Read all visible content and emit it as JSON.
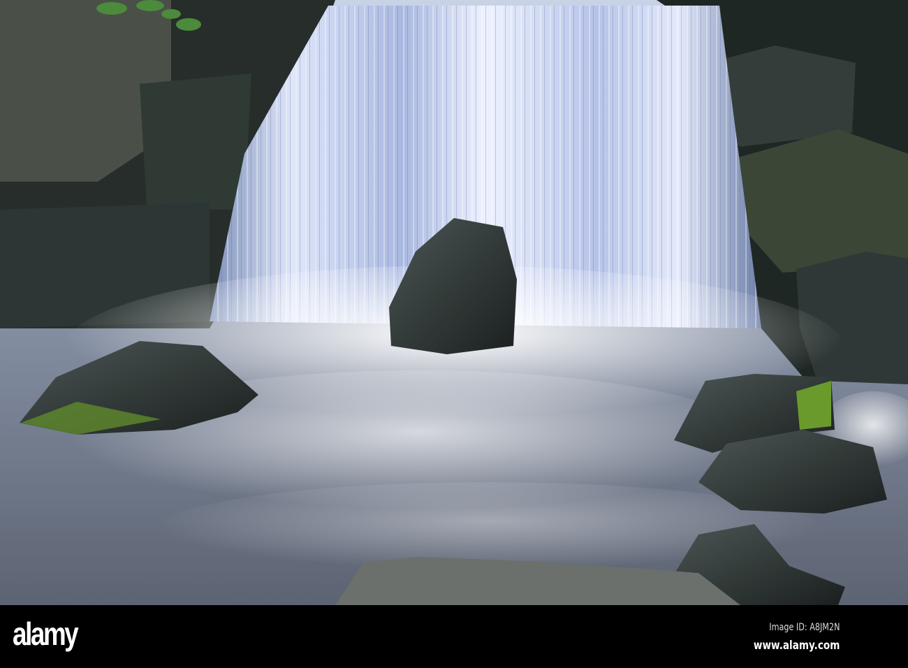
{
  "photo": {
    "subject": "waterfall",
    "colors": {
      "water": "#e8eefc",
      "pool": "#6f7a8c",
      "rock": "#2a3230",
      "moss": "#5d8a2a"
    }
  },
  "footer": {
    "logo": "alamy",
    "image_id": "Image ID: A8JM2N",
    "website": "www.alamy.com"
  }
}
